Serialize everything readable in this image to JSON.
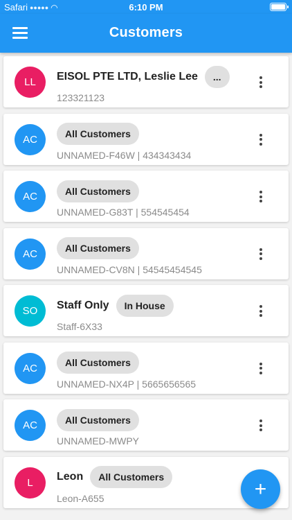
{
  "status_bar": {
    "carrier": "Safari",
    "signal_icon": "signal-icon",
    "wifi_icon": "wifi-icon",
    "time": "6:10 PM",
    "battery_icon": "battery-icon",
    "battery_level": 1.0
  },
  "app_bar": {
    "menu_icon": "hamburger-menu-icon",
    "title": "Customers",
    "color": "#2196f3"
  },
  "customers": [
    {
      "initials": "LL",
      "avatar_color": "#e91e63",
      "name": "EISOL PTE LTD, Leslie Lee",
      "tag": "...",
      "subtitle": "123321123"
    },
    {
      "initials": "AC",
      "avatar_color": "#2196f3",
      "name": "",
      "tag": "All Customers",
      "subtitle": "UNNAMED-F46W | 434343434"
    },
    {
      "initials": "AC",
      "avatar_color": "#2196f3",
      "name": "",
      "tag": "All Customers",
      "subtitle": "UNNAMED-G83T | 554545454"
    },
    {
      "initials": "AC",
      "avatar_color": "#2196f3",
      "name": "",
      "tag": "All Customers",
      "subtitle": "UNNAMED-CV8N | 54545454545"
    },
    {
      "initials": "SO",
      "avatar_color": "#00bcd4",
      "name": "Staff Only",
      "tag": "In House",
      "subtitle": "Staff-6X33"
    },
    {
      "initials": "AC",
      "avatar_color": "#2196f3",
      "name": "",
      "tag": "All Customers",
      "subtitle": "UNNAMED-NX4P | 5665656565"
    },
    {
      "initials": "AC",
      "avatar_color": "#2196f3",
      "name": "",
      "tag": "All Customers",
      "subtitle": "UNNAMED-MWPY"
    },
    {
      "initials": "L",
      "avatar_color": "#e91e63",
      "name": "Leon",
      "tag": "All Customers",
      "subtitle": "Leon-A655"
    }
  ],
  "row_menu_icon": "more-vert-icon",
  "fab": {
    "icon": "plus-icon",
    "label": "+"
  }
}
